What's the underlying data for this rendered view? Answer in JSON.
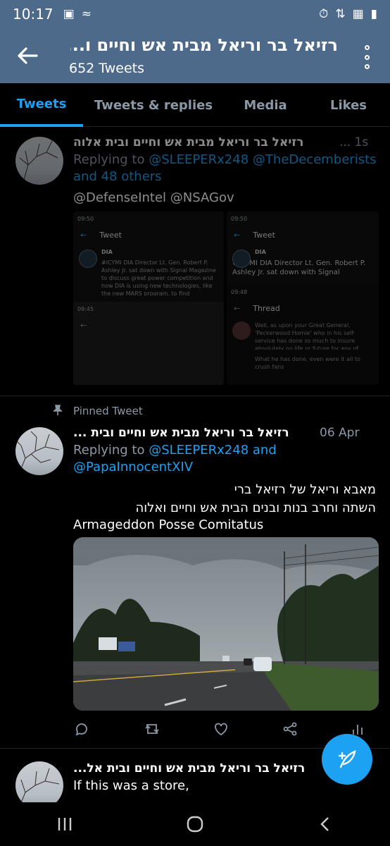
{
  "status_bar": {
    "time": "10:17"
  },
  "header": {
    "title": "רזיאל בר וריאל מבית אש וחיים ו...",
    "tweet_count": "652 Tweets"
  },
  "tabs": [
    {
      "label": "Tweets",
      "active": true
    },
    {
      "label": "Tweets & replies"
    },
    {
      "label": "Media"
    },
    {
      "label": "Likes"
    }
  ],
  "tweet1": {
    "name": "רזיאל בר וריאל מבית אש וחיים ובית אלוה",
    "time": "... 1s",
    "replying_to": "Replying to",
    "mentions": "@SLEEPERx248 @TheDecemberists",
    "mentions2": "and 48 others",
    "body": "@DefenseIntel @NSAGov",
    "screenshot_left": {
      "status": "09:50",
      "title": "Tweet",
      "account": "DIA",
      "text": "#ICYMI DIA Director Lt. Gen. Robert P. Ashley Jr. sat down with Signal Magazine to discuss great power competition and how DIA is using new technologies, like the new MARS program, to find enterprise solutions. Read more here:",
      "status2": "09:45"
    },
    "screenshot_right": {
      "status": "09:50",
      "title": "Tweet",
      "account": "DIA",
      "text": "#ICYMI DIA Director Lt. Gen. Robert P. Ashley Jr. sat down with Signal Magazine",
      "status2": "09:48",
      "thread_title": "Thread",
      "thread_text": "Well, as upon your Great General, 'Peckerwood Homie' who in his self-service has done so much to insure absolutely no life or future for any of your vile brood; and there is no Saving him.",
      "thread_text2": "What he has done, even were it all to crush fans"
    }
  },
  "tweet2": {
    "pinned_label": "Pinned Tweet",
    "name": "רזיאל בר וריאל מבית אש וחיים ובית ...",
    "time": "06 Apr",
    "replying_to": "Replying to",
    "mentions": "@SLEEPERx248 and",
    "mentions2": "@PapaInnocentXIV",
    "body_line1": "מאבא וריאל של רזיאל ברי",
    "body_line2": "השתה וחרב בנות ובנים הבית אש וחיים ואלוה",
    "body_line3": "Armageddon Posse Comitatus"
  },
  "tweet3": {
    "name": "רזיאל בר וריאל מבית אש וחיים ובית אל...",
    "body": "If this was a store,"
  },
  "colors": {
    "header_bg": "#4e6a8b",
    "accent": "#1da1f2",
    "muted": "#8b98a5"
  }
}
